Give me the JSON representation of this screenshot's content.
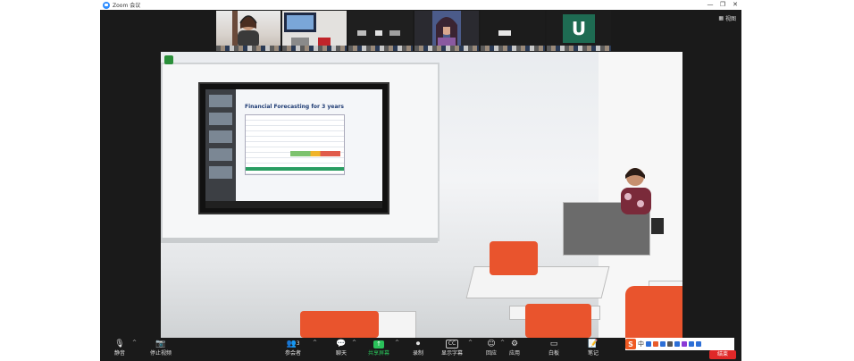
{
  "window": {
    "title": "Zoom 会议",
    "controls": {
      "minimize": "—",
      "restore": "❐",
      "close": "✕"
    }
  },
  "view_option": {
    "label": "视图",
    "icon": "grid-icon"
  },
  "participants_strip": [
    {
      "type": "camera",
      "content": "woman-with-headset"
    },
    {
      "type": "camera",
      "content": "room-with-monitor"
    },
    {
      "type": "pixelated"
    },
    {
      "type": "camera",
      "content": "woman-portrait"
    },
    {
      "type": "pixelated"
    },
    {
      "type": "avatar",
      "letter": "U",
      "color": "#1e6b52"
    }
  ],
  "shared_video": {
    "slide_title": "Financial Forecasting for 3 years"
  },
  "toolbar": {
    "mute": {
      "label": "静音",
      "icon": "microphone-icon"
    },
    "video": {
      "label": "停止视频",
      "icon": "camera-icon"
    },
    "participants": {
      "label": "参会者",
      "count": "3",
      "icon": "participants-icon"
    },
    "chat": {
      "label": "聊天",
      "icon": "chat-icon"
    },
    "share": {
      "label": "共享屏幕",
      "icon": "share-screen-icon",
      "color": "#2ac15a"
    },
    "record": {
      "label": "录制",
      "icon": "record-icon"
    },
    "captions": {
      "label": "显示字幕",
      "icon": "cc-icon",
      "badge": "CC"
    },
    "reactions": {
      "label": "回应",
      "icon": "reaction-icon"
    },
    "apps": {
      "label": "应用",
      "icon": "apps-icon"
    },
    "whiteboard": {
      "label": "白板",
      "icon": "whiteboard-icon"
    },
    "notes": {
      "label": "笔记",
      "icon": "notes-icon"
    },
    "end": {
      "label": "结束",
      "color": "#e02828"
    }
  },
  "ime_bar": {
    "logo": "S",
    "label": "中"
  }
}
